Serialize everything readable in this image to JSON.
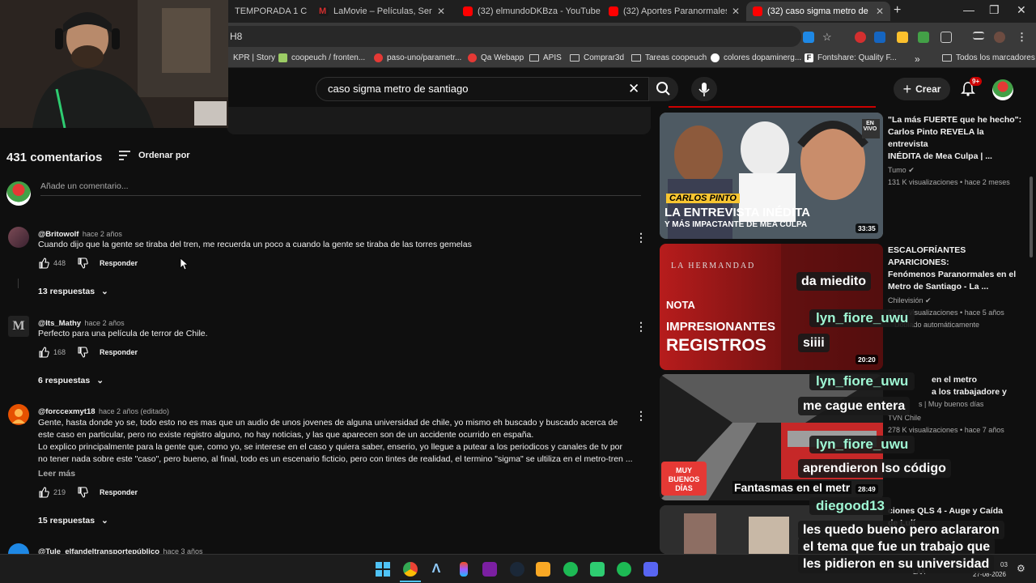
{
  "browser": {
    "tabs": [
      {
        "label": "TEMPORADA 1 C",
        "color": "#888888"
      },
      {
        "label": "LaMovie – Películas, Series y An",
        "color": "#d32f2f"
      },
      {
        "label": "(32) elmundoDKBza - YouTube",
        "color": "#ff0000"
      },
      {
        "label": "(32) Aportes Paranormales de S",
        "color": "#ff0000"
      },
      {
        "label": "(32) caso sigma metro de santia",
        "color": "#ff0000"
      }
    ],
    "url_fragment": "H8",
    "bookmarks": [
      {
        "label": "KPR | Story",
        "type": "page"
      },
      {
        "label": "coopeuch / fronten...",
        "type": "page"
      },
      {
        "label": "paso-uno/parametr...",
        "type": "page"
      },
      {
        "label": "Qa Webapp",
        "type": "page"
      },
      {
        "label": "APIS",
        "type": "folder"
      },
      {
        "label": "Comprar3d",
        "type": "folder"
      },
      {
        "label": "Tareas coopeuch",
        "type": "folder"
      },
      {
        "label": "colores dopaminerg...",
        "type": "page"
      },
      {
        "label": "Fontshare: Quality F...",
        "type": "page"
      }
    ],
    "all_bookmarks": "Todos los marcadores"
  },
  "youtube": {
    "search_query": "caso sigma metro de santiago",
    "create_label": "Crear",
    "notif_count": "9+"
  },
  "comments": {
    "count_label": "431 comentarios",
    "sort_label": "Ordenar por",
    "add_placeholder": "Añade un comentario...",
    "reply_label": "Responder",
    "read_more": "Leer más",
    "items": [
      {
        "author": "@Britowolf",
        "time": "hace 2 años",
        "text": "Cuando dijo que la gente se tiraba del tren, me recuerda un poco a cuando la gente se tiraba de las torres gemelas",
        "likes": "448",
        "replies": "13 respuestas"
      },
      {
        "author": "@Its_Mathy",
        "time": "hace 2 años",
        "text": "Perfecto para una película de terror de Chile.",
        "likes": "168",
        "replies": "6 respuestas"
      },
      {
        "author": "@forccexmyt18",
        "time": "hace 2 años (editado)",
        "text1": "Gente, hasta donde yo se, todo esto no es mas que un audio de unos jovenes de alguna universidad de chile, yo mismo eh buscado y buscado acerca de",
        "text2": "este caso en particular, pero no existe registro alguno, no hay noticias, y las que aparecen son de un accidente ocurrido en españa.",
        "text3": "Lo explico principalmente para la gente que, como yo, se interese en el caso y quiera saber, enserio, yo llegue a putear a los periodicos y canales de tv por",
        "text4": "no tener nada sobre este \"caso\", pero bueno, al final, todo es un escenario ficticio, pero con tintes de realidad, el termino \"sigma\" se ultiliza en el metro-tren ...",
        "likes": "219",
        "replies": "15 respuestas"
      },
      {
        "author": "@Tule_elfandeltransportepúblico",
        "time": "hace 3 años"
      }
    ]
  },
  "recommendations": [
    {
      "title1": "\"La más FUERTE que he hecho\":",
      "title2": "Carlos Pinto REVELA la entrevista",
      "title3": "INÉDITA de Mea Culpa | ...",
      "channel": "Tumo",
      "stats": "131 K visualizaciones • hace 2 meses",
      "duration": "33:35",
      "thumb_text1": "CARLOS PINTO",
      "thumb_text2": "LA ENTREVISTA INÉDITA",
      "thumb_text3": "Y MÁS IMPACTANTE DE MEA CULPA",
      "thumb_badge": "EN VIVO"
    },
    {
      "title1": "ESCALOFRÍANTES APARICIONES:",
      "title2": "Fenómenos Paranormales en el",
      "title3": "Metro de Santiago - La ...",
      "channel": "Chilevisión",
      "stats": "235 K visualizaciones • hace 5 años",
      "dubbed": "Doblado automáticamente",
      "duration": "20:20",
      "thumb_text1": "LA HERMANDAD",
      "thumb_text2": "NOTA",
      "thumb_text3": "IMPRESIONANTES",
      "thumb_text4": "REGISTROS"
    },
    {
      "title1": "en el metro",
      "title2": "a los trabajadore y",
      "title3": "s | Muy buenos días",
      "channel": "TVN Chile",
      "stats": "278 K visualizaciones • hace 7 años",
      "duration": "28:49",
      "thumb_text1": "MUY BUENOS DÍAS",
      "thumb_text2": "Fantasmas en el metr"
    },
    {
      "title1": "ciones QLS 4 - Auge y Caída",
      "title2": "de Lulí"
    }
  ],
  "chat": [
    {
      "user": "lyn_fiore_uwu",
      "msg": "siiii"
    },
    {
      "user": "lyn_fiore_uwu",
      "msg": "me cague entera"
    },
    {
      "user": "lyn_fiore_uwu",
      "msg": "aprendieron lso código"
    },
    {
      "user": "diegood13",
      "msg1": "les quedo bueno pero aclararon",
      "msg2": "el tema que fue un trabajo que",
      "msg3": "les pidieron en su universidad"
    }
  ],
  "chat_partial": "da miedito",
  "taskbar": {
    "lang": "LAA",
    "date": "27-08-2026",
    "time_fragment": "03"
  }
}
